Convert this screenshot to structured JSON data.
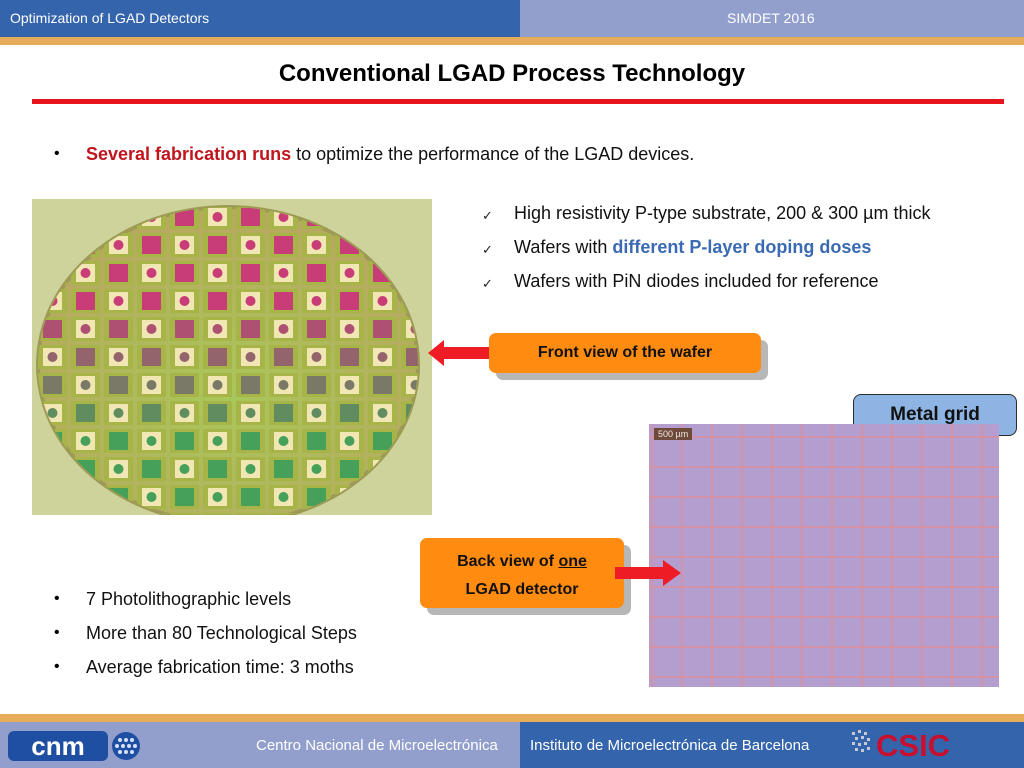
{
  "header": {
    "left_title": "Optimization of LGAD Detectors",
    "right_title": "SIMDET 2016"
  },
  "slide": {
    "title": "Conventional LGAD Process Technology",
    "intro_bullet": {
      "highlight": "Several fabrication runs",
      "rest": " to optimize the performance of the LGAD devices."
    },
    "checklist": [
      {
        "text": "High resistivity P-type substrate, 200 & 300 µm thick"
      },
      {
        "prefix": "Wafers with ",
        "highlight": "different P-layer doping doses"
      },
      {
        "text": "Wafers with PiN diodes included for reference"
      }
    ],
    "check_glyph": "✓",
    "bullet_glyph": "•",
    "callouts": {
      "front": "Front view of the wafer",
      "back_prefix": "Back view of ",
      "back_underlined": "one",
      "back_line2": "LGAD detector",
      "metal_grid": "Metal  grid"
    },
    "grid_image": {
      "scale_label": "500 µm"
    },
    "bottom_bullets": [
      "7 Photolithographic levels",
      "More than 80 Technological Steps",
      "Average fabrication time: 3 moths"
    ],
    "images": {
      "wafer": "wafer-front-photo",
      "grid": "metal-grid-micrograph"
    }
  },
  "footer": {
    "left_logo": "cnm",
    "left_text": "Centro Nacional de Microelectrónica",
    "right_text": "Instituto de Microelectrónica de Barcelona",
    "right_logo": "CSIC"
  },
  "colors": {
    "header_blue": "#3464ab",
    "header_lilac": "#929fcd",
    "accent_orange": "#e6ac5a",
    "title_rule_red": "#e8141c",
    "highlight_red": "#c0151d",
    "highlight_blue": "#3a6ab3",
    "callout_orange": "#ff8b10",
    "metal_box_blue": "#8db4e2",
    "arrow_red": "#ee1c24",
    "csic_red": "#c8102e"
  }
}
